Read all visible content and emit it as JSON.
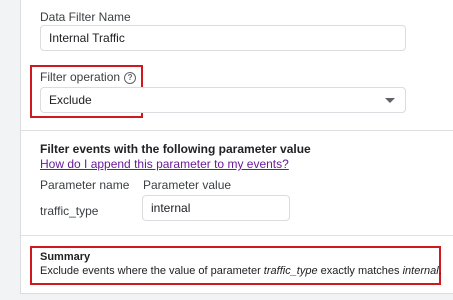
{
  "data_filter_name": {
    "label": "Data Filter Name",
    "value": "Internal Traffic"
  },
  "filter_operation": {
    "label": "Filter operation",
    "help_icon": "help-circle-icon",
    "selected": "Exclude",
    "dropdown_icon": "caret-down-icon"
  },
  "parameter_section": {
    "title": "Filter events with the following parameter value",
    "help_link": "How do I append this parameter to my events?",
    "name_header": "Parameter name",
    "value_header": "Parameter value",
    "name": "traffic_type",
    "value": "internal"
  },
  "summary": {
    "title": "Summary",
    "prefix": "Exclude events where the value of parameter ",
    "param": "traffic_type",
    "middle": " exactly matches ",
    "match_value": "internal",
    "suffix": "."
  },
  "colors": {
    "highlight": "#d0191f",
    "link": "#6a1b9a"
  }
}
